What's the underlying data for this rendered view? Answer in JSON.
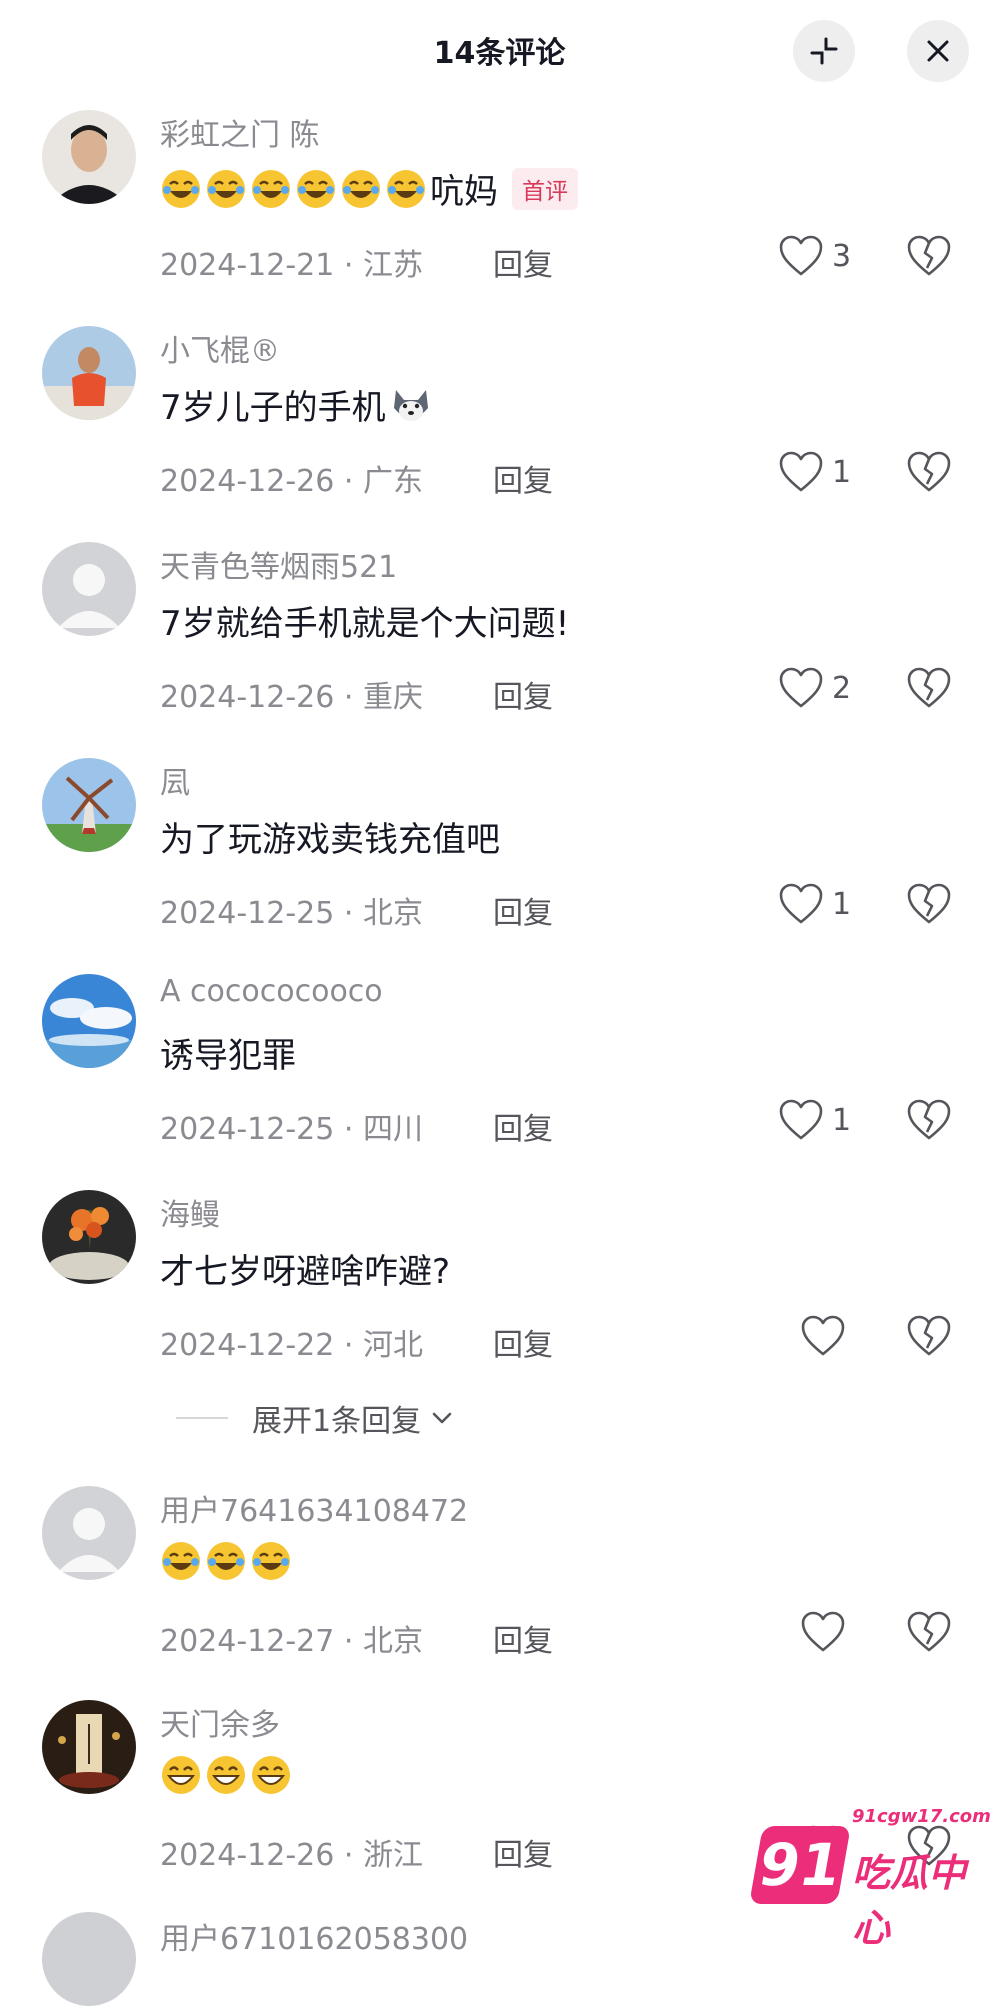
{
  "header": {
    "title": "14条评论"
  },
  "comments": [
    {
      "username": "彩虹之门 陈",
      "text": "吭妈",
      "emoji_count": 6,
      "emoji": "laughing-tears-emoji",
      "badge": "首评",
      "date": "2024-12-21",
      "location": "江苏",
      "reply": "回复",
      "likes": "3"
    },
    {
      "username": "小飞棍®",
      "text": "7岁儿子的手机",
      "suffix_emoji": "husky-emoji",
      "date": "2024-12-26",
      "location": "广东",
      "reply": "回复",
      "likes": "1"
    },
    {
      "username": "天青色等烟雨521",
      "text": "7岁就给手机就是个大问题!",
      "date": "2024-12-26",
      "location": "重庆",
      "reply": "回复",
      "likes": "2"
    },
    {
      "username": "凨",
      "text": "为了玩游戏卖钱充值吧",
      "date": "2024-12-25",
      "location": "北京",
      "reply": "回复",
      "likes": "1"
    },
    {
      "username": "A cocococooco",
      "text": "诱导犯罪",
      "date": "2024-12-25",
      "location": "四川",
      "reply": "回复",
      "likes": "1"
    },
    {
      "username": "海鳗",
      "text": "才七岁呀避啥咋避?",
      "date": "2024-12-22",
      "location": "河北",
      "reply": "回复",
      "likes": ""
    },
    {
      "username": "用户7641634108472",
      "text": "",
      "emoji_count": 3,
      "emoji": "laughing-tears-emoji",
      "date": "2024-12-27",
      "location": "北京",
      "reply": "回复",
      "likes": ""
    },
    {
      "username": "天门余多",
      "text": "",
      "emoji_count": 3,
      "emoji": "grinning-emoji",
      "date": "2024-12-26",
      "location": "浙江",
      "reply": "回复",
      "likes": ""
    }
  ],
  "expand_replies": {
    "label": "展开1条回复"
  },
  "partial_next": {
    "username": "用户6710162058300"
  },
  "watermark": {
    "badge": "91",
    "url": "91cgw17.com",
    "name": "吃瓜中心"
  },
  "colors": {
    "accent": "#ec2d7a",
    "badge_text": "#d83a5a",
    "muted": "#8a8b91"
  }
}
